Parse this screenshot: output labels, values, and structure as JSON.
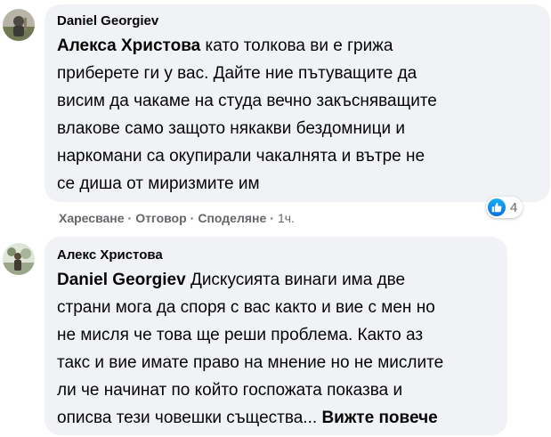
{
  "comments": [
    {
      "author": "Daniel Georgiev",
      "mention": "Алекса Христова",
      "lines": [
        " като толкова ви е грижа",
        "приберете ги у вас. Дайте ние пътуващите да",
        "висим да чакаме на студа вечно закъсняващите",
        "влакове само защото някакви бездомници и",
        "наркомани са окупирали чакалнята и вътре не",
        "се диша от миризмите им"
      ],
      "actions": {
        "like": "Харесване",
        "reply": "Отговор",
        "share": "Споделяне",
        "separator": "·",
        "time": "1ч."
      },
      "reactions": {
        "icon": "like-icon",
        "count": "4"
      }
    },
    {
      "author": "Алекс Христова",
      "mention": "Daniel Georgiev",
      "lines": [
        " Дискусията винаги има две",
        "страни мога да споря с вас както и вие с мен но",
        "не мисля че това ще реши проблема. Както аз",
        "такс и вие имате право на мнение но не мислите",
        "ли че начинат по който госпожата показва и",
        "описва тези човешки същества..."
      ],
      "see_more": "Вижте повече"
    }
  ],
  "colors": {
    "bubble_bg": "#f0f2f5",
    "secondary_text": "#65676b",
    "like_blue": "#0a6fe0"
  }
}
